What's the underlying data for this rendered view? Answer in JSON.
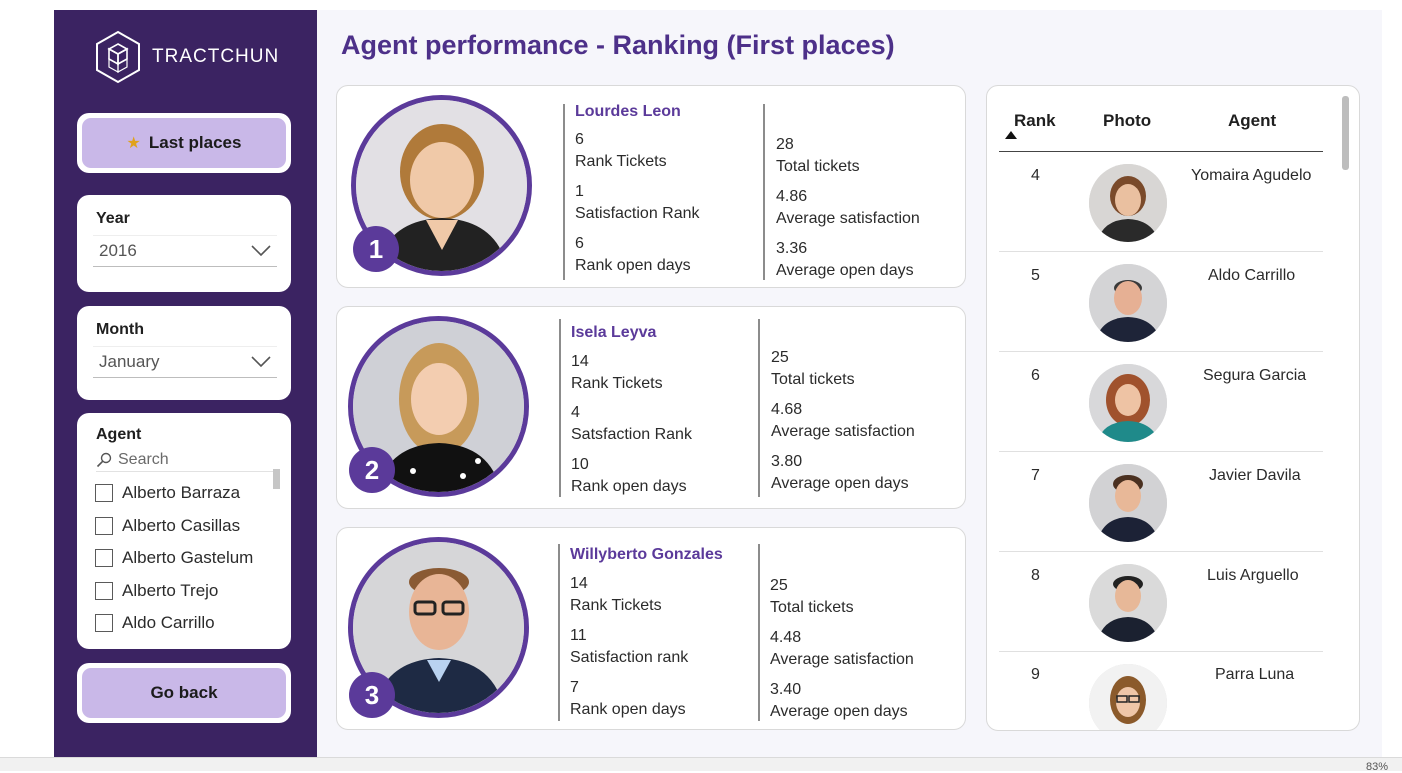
{
  "brand": {
    "name": "TRACTCHUN",
    "icon": "hexagon-cubes-icon"
  },
  "page_title": "Agent performance - Ranking (First places)",
  "sidebar": {
    "last_places_label": "Last places",
    "last_places_icon": "medal-icon",
    "year": {
      "title": "Year",
      "value": "2016"
    },
    "month": {
      "title": "Month",
      "value": "January"
    },
    "agent": {
      "title": "Agent",
      "search_placeholder": "Search",
      "items": [
        "Alberto Barraza",
        "Alberto Casillas",
        "Alberto Gastelum",
        "Alberto Trejo",
        "Aldo Carrillo"
      ]
    },
    "go_back_label": "Go back"
  },
  "podium": [
    {
      "rank": "1",
      "name": "Lourdes Leon",
      "left": [
        {
          "value": "6",
          "label": "Rank Tickets"
        },
        {
          "value": "1",
          "label": "Satisfaction Rank"
        },
        {
          "value": "6",
          "label": "Rank open days"
        }
      ],
      "right": [
        {
          "value": "28",
          "label": "Total tickets"
        },
        {
          "value": "4.86",
          "label": "Average satisfaction"
        },
        {
          "value": "3.36",
          "label": "Average open days"
        }
      ]
    },
    {
      "rank": "2",
      "name": "Isela Leyva",
      "left": [
        {
          "value": "14",
          "label": "Rank Tickets"
        },
        {
          "value": "4",
          "label": "Satsfaction Rank"
        },
        {
          "value": "10",
          "label": "Rank open days"
        }
      ],
      "right": [
        {
          "value": "25",
          "label": "Total tickets"
        },
        {
          "value": "4.68",
          "label": "Average satisfaction"
        },
        {
          "value": "3.80",
          "label": "Average open days"
        }
      ]
    },
    {
      "rank": "3",
      "name": "Willyberto Gonzales",
      "left": [
        {
          "value": "14",
          "label": "Rank Tickets"
        },
        {
          "value": "11",
          "label": "Satisfaction rank"
        },
        {
          "value": "7",
          "label": "Rank open days"
        }
      ],
      "right": [
        {
          "value": "25",
          "label": "Total tickets"
        },
        {
          "value": "4.48",
          "label": "Average satisfaction"
        },
        {
          "value": "3.40",
          "label": "Average open days"
        }
      ]
    }
  ],
  "table": {
    "headers": [
      "Rank",
      "Photo",
      "Agent"
    ],
    "rows": [
      {
        "rank": "4",
        "agent": "Yomaira Agudelo"
      },
      {
        "rank": "5",
        "agent": "Aldo Carrillo"
      },
      {
        "rank": "6",
        "agent": "Segura Garcia"
      },
      {
        "rank": "7",
        "agent": "Javier Davila"
      },
      {
        "rank": "8",
        "agent": "Luis Arguello"
      },
      {
        "rank": "9",
        "agent": "Parra Luna"
      }
    ]
  },
  "status_bar": {
    "zoom": "83%"
  },
  "colors": {
    "sidebar": "#3b2362",
    "accent": "#5b3a9a",
    "button": "#c9b8e8"
  }
}
